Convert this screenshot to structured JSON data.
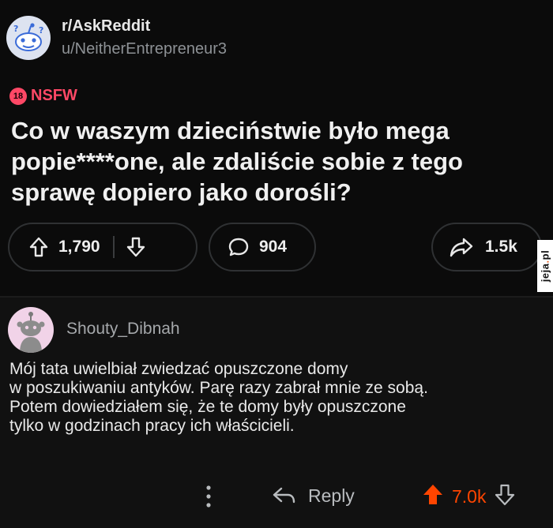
{
  "post": {
    "subreddit": "r/AskReddit",
    "author": "u/NeitherEntrepreneur3",
    "nsfw_badge": "18",
    "nsfw_label": "NSFW",
    "title": "Co w waszym dzieciństwie było mega popie****one, ale zdaliście sobie z tego sprawę dopiero jako dorośli?",
    "votes": "1,790",
    "comments": "904",
    "shares": "1.5k"
  },
  "comment": {
    "author": "Shouty_Dibnah",
    "body_lines": [
      "Mój tata uwielbiał zwiedzać opuszczone domy",
      "w poszukiwaniu antyków. Parę razy zabrał mnie ze sobą.",
      "Potem dowiedziałem się, że te domy były opuszczone",
      "tylko w godzinach pracy ich właścicieli."
    ],
    "reply_label": "Reply",
    "score": "7.0k",
    "upvoted": true
  },
  "watermark": {
    "name": "jeja",
    "dot": ".",
    "tld": "pl"
  },
  "colors": {
    "background": "#0b0b0b",
    "comment_background": "#111111",
    "nsfw": "#ff4866",
    "upvote_accent": "#ff4500",
    "muted_text": "#8d9195"
  },
  "icons": {
    "subreddit_avatar": "reddit-snoo-icon",
    "upvote": "arrow-up-outline-icon",
    "downvote": "arrow-down-outline-icon",
    "comments": "speech-bubble-icon",
    "share": "share-arrow-icon",
    "more": "vertical-ellipsis-icon",
    "reply": "reply-arrow-icon",
    "comment_upvoted": "arrow-up-filled-icon"
  }
}
